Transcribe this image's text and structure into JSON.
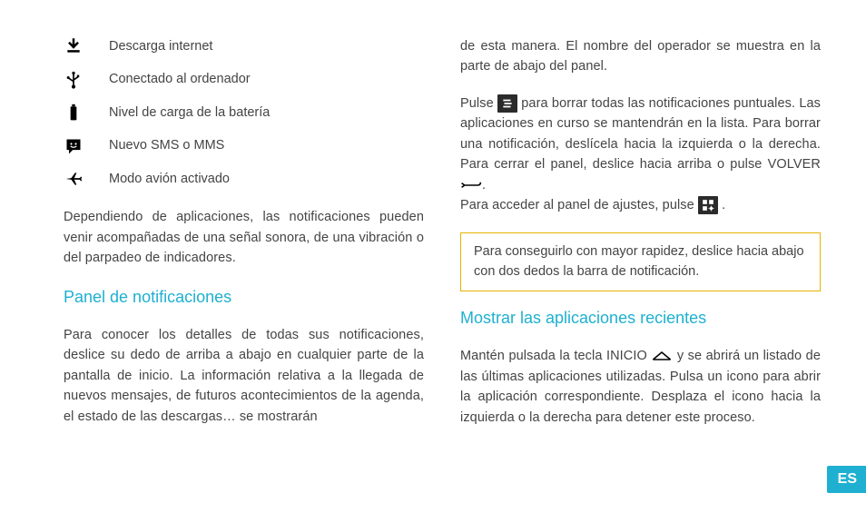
{
  "icons": {
    "download": {
      "label": "Descarga internet"
    },
    "usb": {
      "label": "Conectado al ordenador"
    },
    "battery": {
      "label": "Nivel de carga de la batería"
    },
    "sms": {
      "label": "Nuevo SMS o MMS"
    },
    "airplane": {
      "label": "Modo avión activado"
    }
  },
  "left": {
    "para1": "Dependiendo de aplicaciones, las notificaciones pueden venir acompañadas de una señal sonora, de una vibración o del parpadeo de indicadores.",
    "heading": "Panel de notificaciones",
    "para2": "Para conocer los detalles de todas sus notificaciones, deslice su dedo de arriba a abajo en cualquier parte de la pantalla de inicio. La información relativa a la llegada de nuevos mensajes, de futuros acontecimientos de la agenda, el estado de las descargas… se mostrarán"
  },
  "right": {
    "para1": "de esta manera. El nombre del operador se muestra en la parte de abajo del panel.",
    "para2a": "Pulse ",
    "para2b": " para borrar todas las notificaciones puntuales. Las aplicaciones en curso se mantendrán en la lista. Para borrar una notificación, deslícela hacia la izquierda o la derecha. Para cerrar el panel, deslice hacia arriba o pulse VOLVER ",
    "para2c": ".",
    "para3a": "Para acceder al panel de ajustes, pulse ",
    "para3b": " .",
    "tip": "Para conseguirlo con mayor rapidez, deslice hacia abajo con dos dedos la barra de notificación.",
    "heading": "Mostrar las aplicaciones recientes",
    "para4a": "Mantén pulsada la tecla INICIO ",
    "para4b": " y se abrirá un listado de las últimas aplicaciones utilizadas. Pulsa un icono para abrir la aplicación correspondiente. Desplaza el icono hacia la izquierda o la derecha para detener este proceso."
  },
  "lang": "ES"
}
